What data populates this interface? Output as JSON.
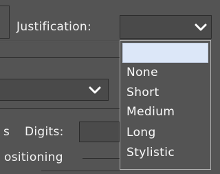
{
  "justification": {
    "label": "Justification:",
    "selected_value": ""
  },
  "dropdown": {
    "options": [
      "",
      "None",
      "Short",
      "Medium",
      "Long",
      "Stylistic"
    ]
  },
  "left_select": {
    "selected_value": ""
  },
  "digits": {
    "label": "Digits:",
    "value": ""
  },
  "positioning": {
    "label": "ositioning"
  },
  "edge_fragment": {
    "text": "s"
  },
  "icons": {
    "justification_arrow": "chevron-down-icon",
    "left_select_arrow": "chevron-down-icon"
  }
}
